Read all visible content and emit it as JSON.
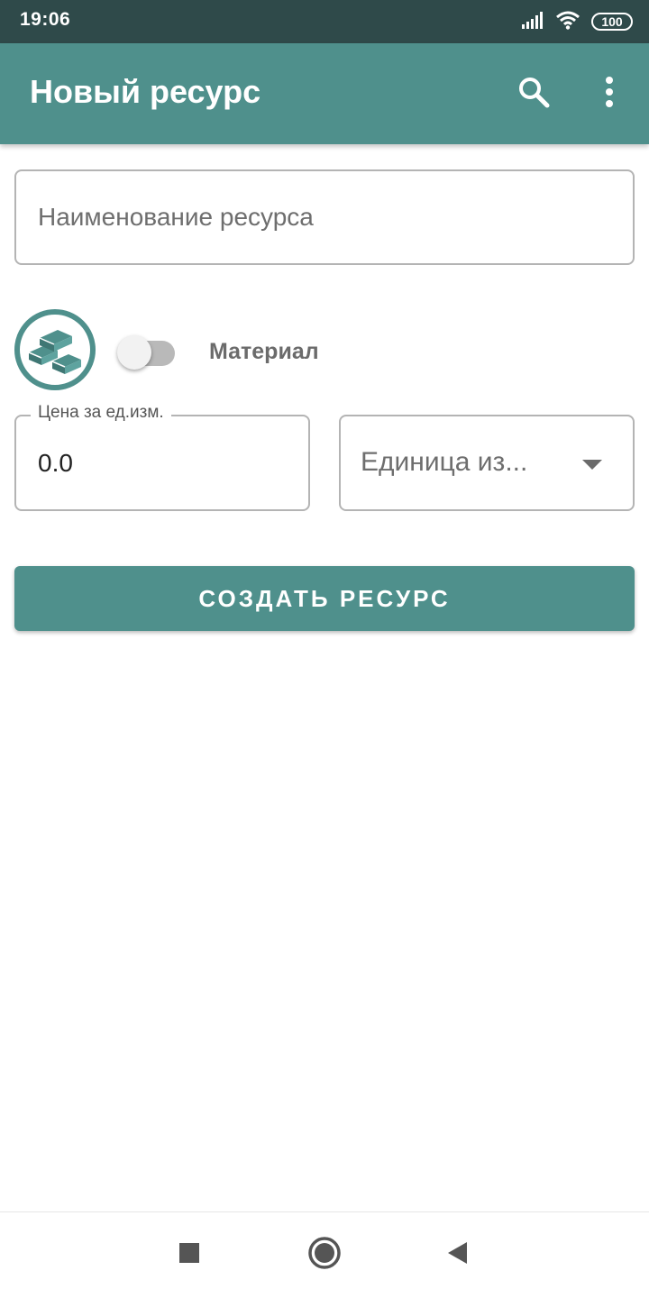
{
  "status_bar": {
    "time": "19:06",
    "battery": "100",
    "icons": [
      "signal-icon",
      "wifi-icon",
      "battery-icon"
    ]
  },
  "app_bar": {
    "title": "Новый ресурс",
    "actions": [
      "search-icon",
      "more-vert-icon"
    ]
  },
  "form": {
    "name_placeholder": "Наименование ресурса",
    "resource_icon": "bricks-icon",
    "material_label": "Материал",
    "material_switch_on": false,
    "price_label": "Цена за ед.изм.",
    "price_value": "0.0",
    "unit_placeholder": "Единица из...",
    "create_button": "СОЗДАТЬ РЕСУРС"
  },
  "nav_bar": {
    "buttons": [
      "recents-square-icon",
      "home-circle-icon",
      "back-triangle-icon"
    ]
  },
  "colors": {
    "primary": "#4f908c",
    "status_bar": "#2f4a4a"
  }
}
